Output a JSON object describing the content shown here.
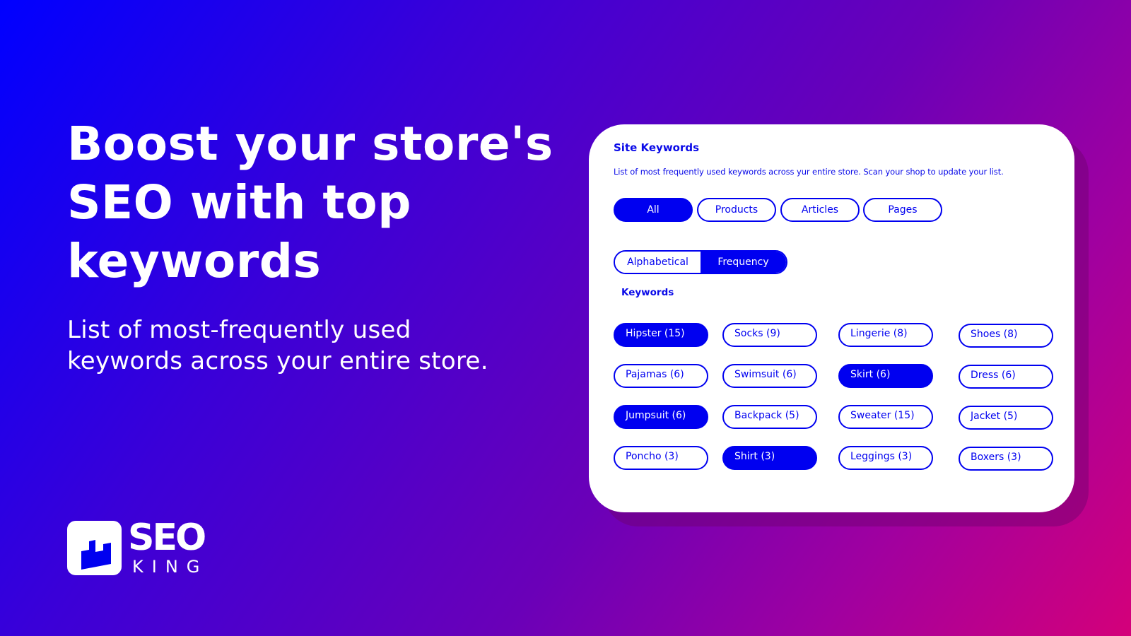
{
  "hero": {
    "headline_lines": [
      "Boost your store's",
      "SEO with top",
      "keywords"
    ],
    "subhead_lines": [
      "List of most-frequently used",
      "keywords across your entire store."
    ]
  },
  "logo": {
    "icon": "crown-bars-icon",
    "word_top": "SEO",
    "word_bottom": "KING"
  },
  "colors": {
    "accent": "#0000f0",
    "background_start": "#0000ff",
    "background_end": "#d4007a",
    "card": "#ffffff"
  },
  "card": {
    "title": "Site Keywords",
    "description": "List of most frequently used keywords across yur entire store. Scan your shop to update your list.",
    "filters": [
      {
        "label": "All",
        "active": true
      },
      {
        "label": "Products",
        "active": false
      },
      {
        "label": "Articles",
        "active": false
      },
      {
        "label": "Pages",
        "active": false
      }
    ],
    "sort": [
      {
        "label": "Alphabetical",
        "active": false
      },
      {
        "label": "Frequency",
        "active": true
      }
    ],
    "keywords_heading": "Keywords",
    "keywords": [
      {
        "label": "Hipster (15)",
        "active": true
      },
      {
        "label": "Socks (9)",
        "active": false
      },
      {
        "label": "Lingerie (8)",
        "active": false
      },
      {
        "label": "Shoes (8)",
        "active": false
      },
      {
        "label": "Pajamas (6)",
        "active": false
      },
      {
        "label": "Swimsuit (6)",
        "active": false
      },
      {
        "label": "Skirt (6)",
        "active": true
      },
      {
        "label": "Dress (6)",
        "active": false
      },
      {
        "label": "Jumpsuit (6)",
        "active": true
      },
      {
        "label": "Backpack (5)",
        "active": false
      },
      {
        "label": "Sweater (15)",
        "active": false
      },
      {
        "label": "Jacket (5)",
        "active": false
      },
      {
        "label": "Poncho (3)",
        "active": false
      },
      {
        "label": "Shirt (3)",
        "active": true
      },
      {
        "label": "Leggings (3)",
        "active": false
      },
      {
        "label": "Boxers (3)",
        "active": false
      }
    ]
  }
}
